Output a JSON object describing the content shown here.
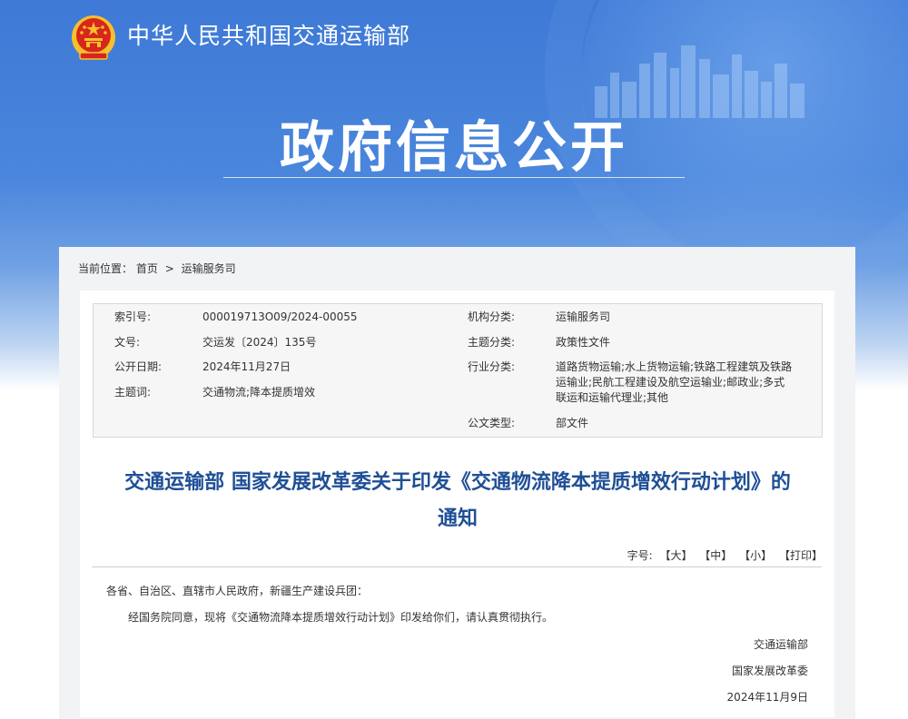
{
  "header": {
    "site_name": "中华人民共和国交通运输部",
    "banner_title": "政府信息公开"
  },
  "breadcrumb": {
    "prefix": "当前位置：",
    "items": [
      "首页",
      "运输服务司"
    ],
    "separator": ">"
  },
  "metadata": {
    "index_no": {
      "label": "索引号:",
      "value": "000019713O09/2024-00055"
    },
    "doc_no": {
      "label": "文号:",
      "value": "交运发〔2024〕135号"
    },
    "publish_date": {
      "label": "公开日期:",
      "value": "2024年11月27日"
    },
    "keywords": {
      "label": "主题词:",
      "value": "交通物流;降本提质增效"
    },
    "org_category": {
      "label": "机构分类:",
      "value": "运输服务司"
    },
    "topic_category": {
      "label": "主题分类:",
      "value": "政策性文件"
    },
    "industry_category": {
      "label": "行业分类:",
      "value": "道路货物运输;水上货物运输;铁路工程建筑及铁路运输业;民航工程建设及航空运输业;邮政业;多式联运和运输代理业;其他"
    },
    "doc_type": {
      "label": "公文类型:",
      "value": "部文件"
    }
  },
  "document": {
    "title_line1": "交通运输部 国家发展改革委关于印发《交通物流降本提质增效行动计划》的",
    "title_line2": "通知",
    "salutation": "各省、自治区、直辖市人民政府，新疆生产建设兵团：",
    "body": "经国务院同意，现将《交通物流降本提质增效行动计划》印发给你们，请认真贯彻执行。",
    "signatory1": "交通运输部",
    "signatory2": "国家发展改革委",
    "date": "2024年11月9日"
  },
  "font_size_bar": {
    "label": "字号:",
    "large": "【大】",
    "medium": "【中】",
    "small": "【小】",
    "print": "【打印】"
  },
  "colors": {
    "banner_blue": "#4a86dc",
    "title_blue": "#1f4f96",
    "emblem_red": "#d7261c",
    "emblem_gold": "#f6c02c"
  }
}
